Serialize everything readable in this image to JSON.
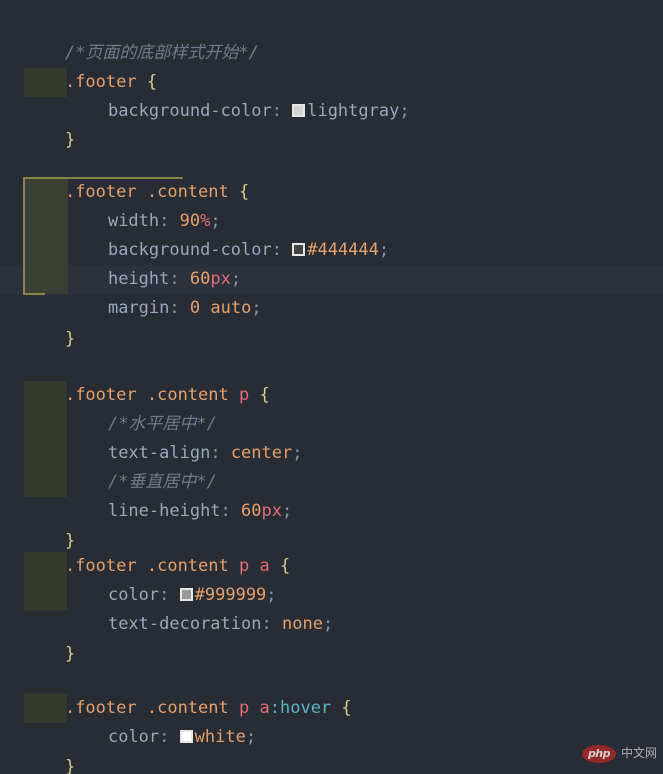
{
  "editor": {
    "background": "#282c34",
    "current_line_background": "#2c313c",
    "indent_guide_color": "#353a2e",
    "scope_border_color": "#8a8547",
    "font_size_px": 17,
    "line_height_px": 29,
    "language": "CSS"
  },
  "palette": {
    "comment": "#6f7a8c",
    "selector": "#e5a06b",
    "tag": "#e06c75",
    "pseudo_class": "#56b6c2",
    "brace": "#d7ce8c",
    "property": "#9aa7bd",
    "punctuation": "#8894a8",
    "value": "#e5a06b",
    "unit": "#e06c75",
    "keyword": "#9aa7bd"
  },
  "code": {
    "line_01_comment": "/*页面的底部样式开始*/",
    "line_02_selector": ".footer",
    "line_02_brace": "{",
    "line_03_prop": "background-color",
    "line_03_colon": ":",
    "line_03_value": "lightgray",
    "line_03_semicolon": ";",
    "line_03_swatch_color": "#d3d3d3",
    "line_04_brace": "}",
    "line_06_selector_a": ".footer",
    "line_06_selector_b": ".content",
    "line_06_brace": "{",
    "line_07_prop": "width",
    "line_07_colon": ":",
    "line_07_value": "90",
    "line_07_unit": "%",
    "line_07_semicolon": ";",
    "line_08_prop": "background-color",
    "line_08_colon": ":",
    "line_08_value": "#444444",
    "line_08_semicolon": ";",
    "line_08_swatch_color": "#444444",
    "line_09_prop": "height",
    "line_09_colon": ":",
    "line_09_value": "60",
    "line_09_unit": "px",
    "line_09_semicolon": ";",
    "line_10_prop": "margin",
    "line_10_colon": ":",
    "line_10_value_a": "0",
    "line_10_value_b": "auto",
    "line_10_semicolon": ";",
    "line_11_brace": "}",
    "line_13_selector_a": ".footer",
    "line_13_selector_b": ".content",
    "line_13_tag": "p",
    "line_13_brace": "{",
    "line_14_comment": "/*水平居中*/",
    "line_15_prop": "text-align",
    "line_15_colon": ":",
    "line_15_value": "center",
    "line_15_semicolon": ";",
    "line_16_comment": "/*垂直居中*/",
    "line_17_prop": "line-height",
    "line_17_colon": ":",
    "line_17_value": "60",
    "line_17_unit": "px",
    "line_17_semicolon": ";",
    "line_18_brace": "}",
    "line_19_selector_a": ".footer",
    "line_19_selector_b": ".content",
    "line_19_tag_p": "p",
    "line_19_tag_a": "a",
    "line_19_brace": "{",
    "line_20_prop": "color",
    "line_20_colon": ":",
    "line_20_value": "#999999",
    "line_20_semicolon": ";",
    "line_20_swatch_color": "#999999",
    "line_21_prop": "text-decoration",
    "line_21_colon": ":",
    "line_21_value": "none",
    "line_21_semicolon": ";",
    "line_22_brace": "}",
    "line_24_selector_a": ".footer",
    "line_24_selector_b": ".content",
    "line_24_tag_p": "p",
    "line_24_tag_a": "a",
    "line_24_pseudo": ":hover",
    "line_24_brace": "{",
    "line_25_prop": "color",
    "line_25_colon": ":",
    "line_25_value": "white",
    "line_25_semicolon": ";",
    "line_25_swatch_color": "#ffffff",
    "line_26_brace": "}"
  },
  "watermark": {
    "logo_text": "php",
    "text": "中文网",
    "logo_color": "#9c2a2a"
  }
}
